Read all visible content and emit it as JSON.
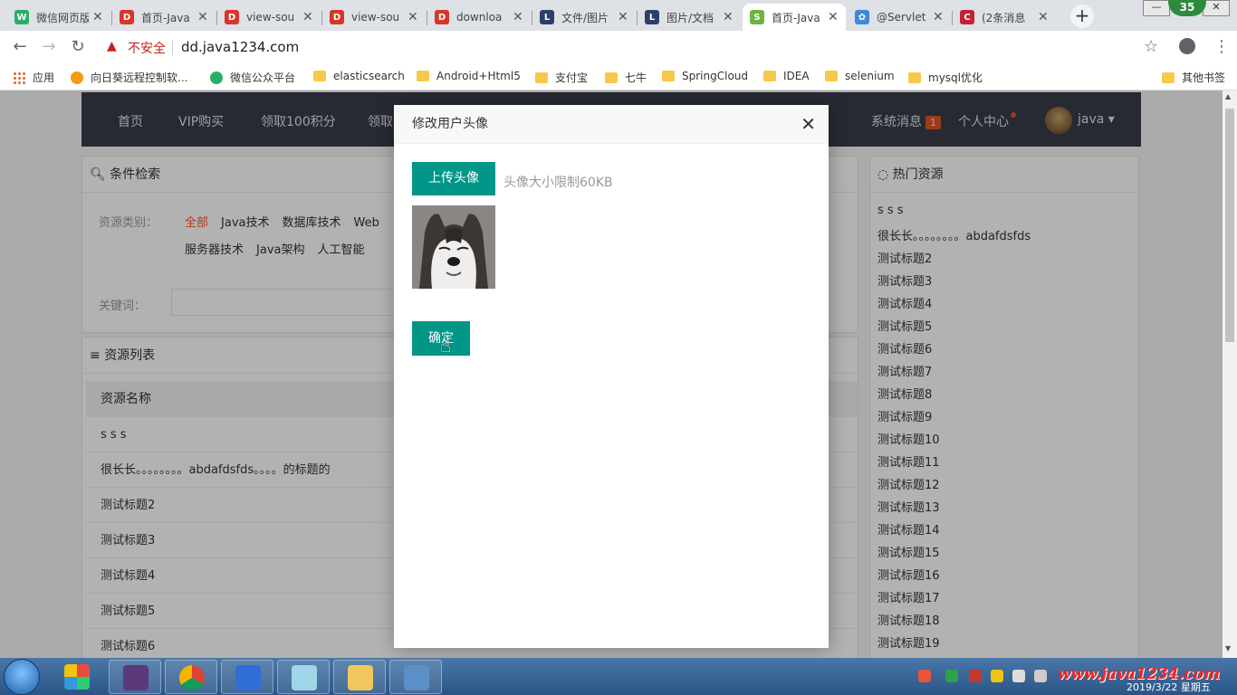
{
  "browser": {
    "tabs": [
      {
        "label": "微信网页版",
        "color": "#2aae67",
        "glyph": "W"
      },
      {
        "label": "首页-Java",
        "color": "#d9352b",
        "glyph": "D"
      },
      {
        "label": "view-sou",
        "color": "#d9352b",
        "glyph": "D"
      },
      {
        "label": "view-sou",
        "color": "#d9352b",
        "glyph": "D"
      },
      {
        "label": "downloa",
        "color": "#d9352b",
        "glyph": "D"
      },
      {
        "label": "文件/图片",
        "color": "#2b3f6a",
        "glyph": "L"
      },
      {
        "label": "图片/文档",
        "color": "#2b3f6a",
        "glyph": "L"
      },
      {
        "label": "首页-Java",
        "color": "#6db33f",
        "glyph": "S"
      },
      {
        "label": "@Servlet",
        "color": "#3b8ad9",
        "glyph": "✿"
      },
      {
        "label": "(2条消息",
        "color": "#c32136",
        "glyph": "C"
      }
    ],
    "active_tab_index": 7,
    "close_glyph": "✕",
    "new_tab_glyph": "+",
    "notification_count": "35",
    "security_label": "不安全",
    "url": "dd.java1234.com",
    "bookmarks": [
      {
        "label": "应用",
        "kind": "apps"
      },
      {
        "label": "向日葵远程控制软...",
        "kind": "dot",
        "color": "#f39c12"
      },
      {
        "label": "微信公众平台",
        "kind": "dot",
        "color": "#2aae67"
      },
      {
        "label": "elasticsearch",
        "kind": "folder"
      },
      {
        "label": "Android+Html5",
        "kind": "folder"
      },
      {
        "label": "支付宝",
        "kind": "folder"
      },
      {
        "label": "七牛",
        "kind": "folder"
      },
      {
        "label": "SpringCloud",
        "kind": "folder"
      },
      {
        "label": "IDEA",
        "kind": "folder"
      },
      {
        "label": "selenium",
        "kind": "folder"
      },
      {
        "label": "mysql优化",
        "kind": "folder"
      }
    ],
    "other_bookmarks": "其他书签"
  },
  "site": {
    "nav": [
      "首页",
      "VIP购买",
      "领取100积分",
      "领取"
    ],
    "system_msg": "系统消息",
    "system_msg_count": "1",
    "personal_center": "个人中心",
    "username": "java",
    "search_panel_title": "条件检索",
    "category_label": "资源类别：",
    "categories_row1": [
      "全部",
      "Java技术",
      "数据库技术",
      "Web"
    ],
    "categories_row2": [
      "服务器技术",
      "Java架构",
      "人工智能"
    ],
    "keyword_label": "关键词：",
    "list_panel_title": "资源列表",
    "list_header": "资源名称",
    "list_rows": [
      "s s s",
      "很长长。。。。。。。。abdafdsfds。。。。的标题的",
      "测试标题2",
      "测试标题3",
      "测试标题4",
      "测试标题5",
      "测试标题6"
    ],
    "hot_title": "热门资源",
    "hot_items": [
      "s s s",
      "很长长。。。。。。。。abdafdsfds",
      "测试标题2",
      "测试标题3",
      "测试标题4",
      "测试标题5",
      "测试标题6",
      "测试标题7",
      "测试标题8",
      "测试标题9",
      "测试标题10",
      "测试标题11",
      "测试标题12",
      "测试标题13",
      "测试标题14",
      "测试标题15",
      "测试标题16",
      "测试标题17",
      "测试标题18",
      "测试标题19"
    ]
  },
  "modal": {
    "title": "修改用户头像",
    "upload_button": "上传头像",
    "size_hint": "头像大小限制60KB",
    "confirm_button": "确定",
    "close_glyph": "✕"
  },
  "taskbar": {
    "watermark": "www.java1234.com",
    "date": "2019/3/22 星期五"
  },
  "colors": {
    "accent_teal": "#009688",
    "nav_bg": "#393d49",
    "active_category": "#ff5722"
  }
}
